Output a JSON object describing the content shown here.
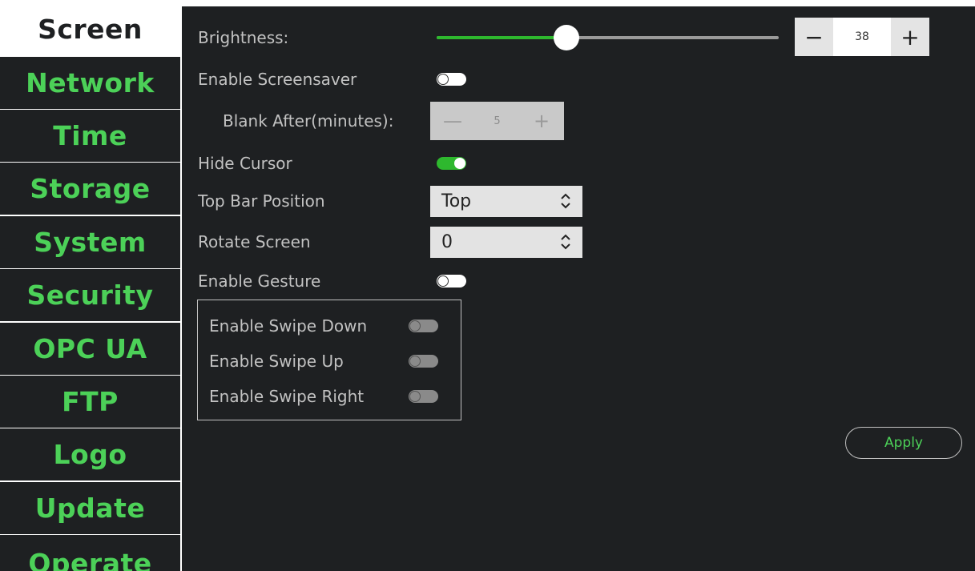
{
  "sidebar": {
    "items": [
      {
        "label": "Screen",
        "active": true
      },
      {
        "label": "Network",
        "active": false
      },
      {
        "label": "Time",
        "active": false
      },
      {
        "label": "Storage",
        "active": false
      },
      {
        "label": "System",
        "active": false
      },
      {
        "label": "Security",
        "active": false
      },
      {
        "label": "OPC UA",
        "active": false
      },
      {
        "label": "FTP",
        "active": false
      },
      {
        "label": "Logo",
        "active": false
      },
      {
        "label": "Update",
        "active": false
      },
      {
        "label": "Operate",
        "active": false
      }
    ]
  },
  "screen": {
    "brightness": {
      "label": "Brightness:",
      "value": "38",
      "level_percent": 38,
      "minus": "−",
      "plus": "+"
    },
    "screensaver": {
      "label": "Enable Screensaver",
      "enabled": false
    },
    "blank_after": {
      "label": "Blank After(minutes):",
      "value": "5",
      "minus": "—",
      "plus": "+",
      "disabled": true
    },
    "hide_cursor": {
      "label": "Hide Cursor",
      "enabled": true
    },
    "top_bar_position": {
      "label": "Top Bar Position",
      "value": "Top"
    },
    "rotate_screen": {
      "label": "Rotate Screen",
      "value": "0"
    },
    "gesture": {
      "label": "Enable Gesture",
      "enabled": false,
      "swipe_down": {
        "label": "Enable Swipe Down",
        "enabled": false
      },
      "swipe_up": {
        "label": "Enable Swipe Up",
        "enabled": false
      },
      "swipe_right": {
        "label": "Enable Swipe Right",
        "enabled": false
      }
    },
    "apply_label": "Apply"
  },
  "colors": {
    "accent_green": "#4cd158",
    "slider_green": "#2eb82e",
    "panel_bg": "#1e2022",
    "text": "#c2c2c2"
  }
}
